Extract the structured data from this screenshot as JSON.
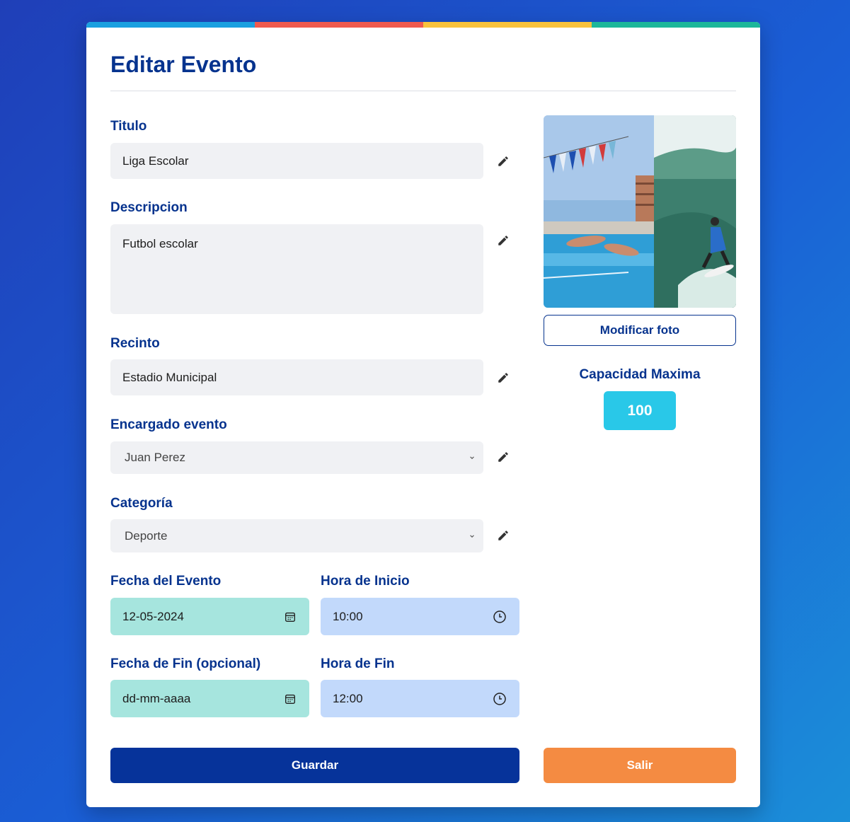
{
  "colors": {
    "primary": "#06338e",
    "stripe": [
      "#1aa0e0",
      "#f05a4e",
      "#f9c23c",
      "#1cb79a"
    ],
    "date_field": "#a6e5de",
    "time_field": "#c2d9fb",
    "capacity": "#29c8e8",
    "exit": "#f48b42"
  },
  "page": {
    "title": "Editar Evento"
  },
  "form": {
    "titulo": {
      "label": "Titulo",
      "value": "Liga Escolar",
      "edit_icon": "pencil-icon"
    },
    "descripcion": {
      "label": "Descripcion",
      "value": "Futbol escolar",
      "edit_icon": "pencil-icon"
    },
    "recinto": {
      "label": "Recinto",
      "value": "Estadio Municipal",
      "edit_icon": "pencil-icon"
    },
    "encargado": {
      "label": "Encargado evento",
      "value": "Juan Perez",
      "edit_icon": "pencil-icon"
    },
    "categoria": {
      "label": "Categoría",
      "value": "Deporte",
      "edit_icon": "pencil-icon"
    },
    "fecha_evento": {
      "label": "Fecha del Evento",
      "value": "12-05-2024",
      "icon": "calendar-icon"
    },
    "hora_inicio": {
      "label": "Hora de Inicio",
      "value": "10:00",
      "icon": "clock-icon"
    },
    "fecha_fin": {
      "label": "Fecha de Fin (opcional)",
      "value": "dd-mm-aaaa",
      "icon": "calendar-icon"
    },
    "hora_fin": {
      "label": "Hora de Fin",
      "value": "12:00",
      "icon": "clock-icon"
    }
  },
  "sidebar": {
    "photo_button": "Modificar foto",
    "capacity_label": "Capacidad Maxima",
    "capacity_value": "100"
  },
  "actions": {
    "save": "Guardar",
    "exit": "Salir"
  }
}
